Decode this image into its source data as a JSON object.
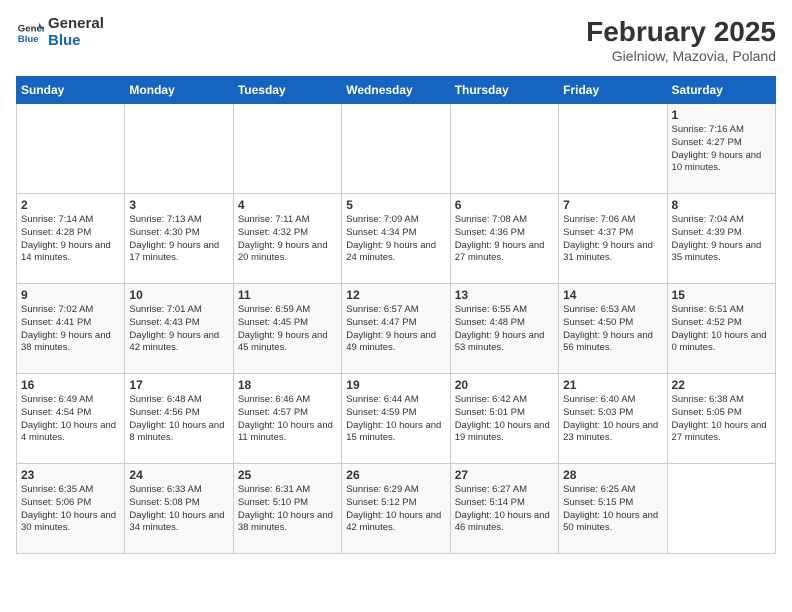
{
  "header": {
    "logo_line1": "General",
    "logo_line2": "Blue",
    "title": "February 2025",
    "subtitle": "Gielniow, Mazovia, Poland"
  },
  "weekdays": [
    "Sunday",
    "Monday",
    "Tuesday",
    "Wednesday",
    "Thursday",
    "Friday",
    "Saturday"
  ],
  "weeks": [
    [
      {
        "day": "",
        "info": ""
      },
      {
        "day": "",
        "info": ""
      },
      {
        "day": "",
        "info": ""
      },
      {
        "day": "",
        "info": ""
      },
      {
        "day": "",
        "info": ""
      },
      {
        "day": "",
        "info": ""
      },
      {
        "day": "1",
        "info": "Sunrise: 7:16 AM\nSunset: 4:27 PM\nDaylight: 9 hours and 10 minutes."
      }
    ],
    [
      {
        "day": "2",
        "info": "Sunrise: 7:14 AM\nSunset: 4:28 PM\nDaylight: 9 hours and 14 minutes."
      },
      {
        "day": "3",
        "info": "Sunrise: 7:13 AM\nSunset: 4:30 PM\nDaylight: 9 hours and 17 minutes."
      },
      {
        "day": "4",
        "info": "Sunrise: 7:11 AM\nSunset: 4:32 PM\nDaylight: 9 hours and 20 minutes."
      },
      {
        "day": "5",
        "info": "Sunrise: 7:09 AM\nSunset: 4:34 PM\nDaylight: 9 hours and 24 minutes."
      },
      {
        "day": "6",
        "info": "Sunrise: 7:08 AM\nSunset: 4:36 PM\nDaylight: 9 hours and 27 minutes."
      },
      {
        "day": "7",
        "info": "Sunrise: 7:06 AM\nSunset: 4:37 PM\nDaylight: 9 hours and 31 minutes."
      },
      {
        "day": "8",
        "info": "Sunrise: 7:04 AM\nSunset: 4:39 PM\nDaylight: 9 hours and 35 minutes."
      }
    ],
    [
      {
        "day": "9",
        "info": "Sunrise: 7:02 AM\nSunset: 4:41 PM\nDaylight: 9 hours and 38 minutes."
      },
      {
        "day": "10",
        "info": "Sunrise: 7:01 AM\nSunset: 4:43 PM\nDaylight: 9 hours and 42 minutes."
      },
      {
        "day": "11",
        "info": "Sunrise: 6:59 AM\nSunset: 4:45 PM\nDaylight: 9 hours and 45 minutes."
      },
      {
        "day": "12",
        "info": "Sunrise: 6:57 AM\nSunset: 4:47 PM\nDaylight: 9 hours and 49 minutes."
      },
      {
        "day": "13",
        "info": "Sunrise: 6:55 AM\nSunset: 4:48 PM\nDaylight: 9 hours and 53 minutes."
      },
      {
        "day": "14",
        "info": "Sunrise: 6:53 AM\nSunset: 4:50 PM\nDaylight: 9 hours and 56 minutes."
      },
      {
        "day": "15",
        "info": "Sunrise: 6:51 AM\nSunset: 4:52 PM\nDaylight: 10 hours and 0 minutes."
      }
    ],
    [
      {
        "day": "16",
        "info": "Sunrise: 6:49 AM\nSunset: 4:54 PM\nDaylight: 10 hours and 4 minutes."
      },
      {
        "day": "17",
        "info": "Sunrise: 6:48 AM\nSunset: 4:56 PM\nDaylight: 10 hours and 8 minutes."
      },
      {
        "day": "18",
        "info": "Sunrise: 6:46 AM\nSunset: 4:57 PM\nDaylight: 10 hours and 11 minutes."
      },
      {
        "day": "19",
        "info": "Sunrise: 6:44 AM\nSunset: 4:59 PM\nDaylight: 10 hours and 15 minutes."
      },
      {
        "day": "20",
        "info": "Sunrise: 6:42 AM\nSunset: 5:01 PM\nDaylight: 10 hours and 19 minutes."
      },
      {
        "day": "21",
        "info": "Sunrise: 6:40 AM\nSunset: 5:03 PM\nDaylight: 10 hours and 23 minutes."
      },
      {
        "day": "22",
        "info": "Sunrise: 6:38 AM\nSunset: 5:05 PM\nDaylight: 10 hours and 27 minutes."
      }
    ],
    [
      {
        "day": "23",
        "info": "Sunrise: 6:35 AM\nSunset: 5:06 PM\nDaylight: 10 hours and 30 minutes."
      },
      {
        "day": "24",
        "info": "Sunrise: 6:33 AM\nSunset: 5:08 PM\nDaylight: 10 hours and 34 minutes."
      },
      {
        "day": "25",
        "info": "Sunrise: 6:31 AM\nSunset: 5:10 PM\nDaylight: 10 hours and 38 minutes."
      },
      {
        "day": "26",
        "info": "Sunrise: 6:29 AM\nSunset: 5:12 PM\nDaylight: 10 hours and 42 minutes."
      },
      {
        "day": "27",
        "info": "Sunrise: 6:27 AM\nSunset: 5:14 PM\nDaylight: 10 hours and 46 minutes."
      },
      {
        "day": "28",
        "info": "Sunrise: 6:25 AM\nSunset: 5:15 PM\nDaylight: 10 hours and 50 minutes."
      },
      {
        "day": "",
        "info": ""
      }
    ]
  ]
}
